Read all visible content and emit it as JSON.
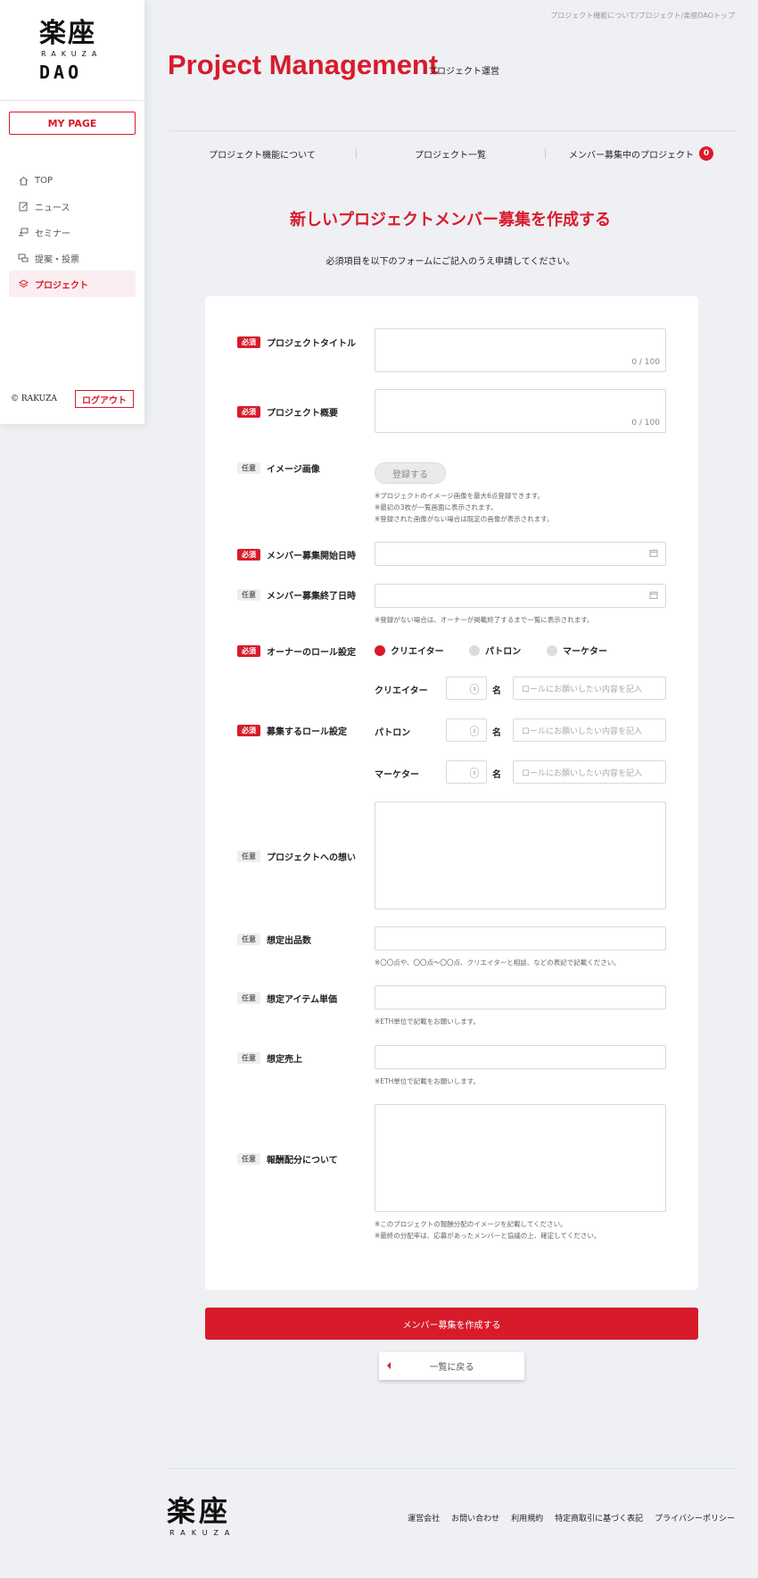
{
  "sidebar": {
    "logo_kanji": "楽座",
    "logo_sub": "RAKUZA",
    "logo_dao": "DAO",
    "mypage": "MY PAGE",
    "items": [
      {
        "label": "TOP",
        "icon": "home-icon"
      },
      {
        "label": "ニュース",
        "icon": "news-icon"
      },
      {
        "label": "セミナー",
        "icon": "seminar-icon"
      },
      {
        "label": "提案・投票",
        "icon": "proposal-icon"
      },
      {
        "label": "プロジェクト",
        "icon": "layers-icon"
      }
    ],
    "copyright": "© RAKUZA",
    "logout": "ログアウト"
  },
  "header": {
    "breadcrumb": "プロジェクト機能について/プロジェクト/楽座DAOトップ",
    "title": "Project Management",
    "subtitle": "プロジェクト運営",
    "tabs": [
      {
        "label": "プロジェクト機能について"
      },
      {
        "label": "プロジェクト一覧"
      },
      {
        "label": "メンバー募集中のプロジェクト",
        "badge": "0"
      }
    ]
  },
  "form": {
    "heading": "新しいプロジェクトメンバー募集を作成する",
    "intro": "必須項目を以下のフォームにご記入のうえ申請してください。",
    "tag_required": "必須",
    "tag_optional": "任意",
    "labels": {
      "title": "プロジェクトタイトル",
      "summary": "プロジェクト概要",
      "image": "イメージ画像",
      "start": "メンバー募集開始日時",
      "end": "メンバー募集終了日時",
      "owner_role": "オーナーのロール設定",
      "recruit_role": "募集するロール設定",
      "thoughts": "プロジェクトへの想い",
      "quantity": "想定出品数",
      "unit_price": "想定アイテム単価",
      "sales": "想定売上",
      "reward": "報酬配分について"
    },
    "title_counter": "0 / 100",
    "summary_counter": "0 / 100",
    "register_button": "登録する",
    "image_hints": [
      "※プロジェクトのイメージ画像を最大6点登録できます。",
      "※最初の3枚が一覧画面に表示されます。",
      "※登録された画像がない場合は既定の画像が表示されます。"
    ],
    "end_hint": "※登録がない場合は、オーナーが掲載終了するまで一覧に表示されます。",
    "owner_roles": [
      {
        "label": "クリエイター",
        "selected": true
      },
      {
        "label": "パトロン",
        "selected": false
      },
      {
        "label": "マーケター",
        "selected": false
      }
    ],
    "recruit_roles": [
      {
        "label": "クリエイター"
      },
      {
        "label": "パトロン"
      },
      {
        "label": "マーケター"
      }
    ],
    "unit": "名",
    "role_placeholder": "ロールにお願いしたい内容を記入",
    "quantity_hint": "※〇〇点や、〇〇点〜〇〇点、クリエイターと相談、などの表記で記載ください。",
    "unit_price_hint": "※ETH単位で記載をお願いします。",
    "sales_hint": "※ETH単位で記載をお願いします。",
    "reward_hints": [
      "※このプロジェクトの報酬分配のイメージを記載してください。",
      "※最終の分配率は、応募があったメンバーと協議の上、確定してください。"
    ],
    "submit": "メンバー募集を作成する",
    "back": "一覧に戻る"
  },
  "footer": {
    "logo": "楽座",
    "logo_sub": "RAKUZA",
    "links": [
      "運営会社",
      "お問い合わせ",
      "利用規約",
      "特定商取引に基づく表記",
      "プライバシーポリシー"
    ]
  },
  "colors": {
    "accent": "#d81b2b",
    "background": "#eef0f4"
  }
}
